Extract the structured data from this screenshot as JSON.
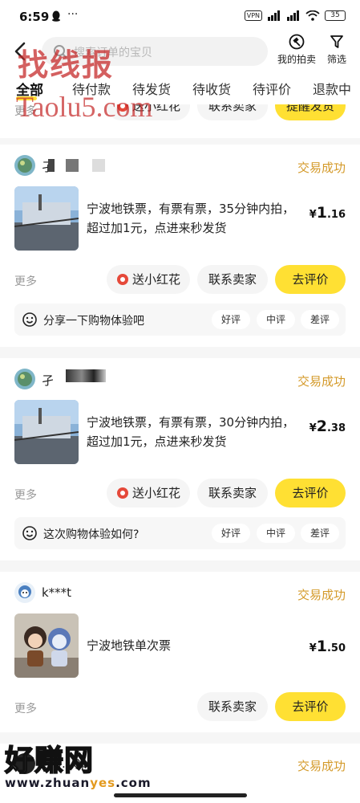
{
  "status_bar": {
    "time": "6:59",
    "more": "···",
    "vpn": "VPN",
    "battery": "35"
  },
  "header": {
    "search_placeholder": "搜索订单的宝贝",
    "my_auctions": "我的拍卖",
    "filter": "筛选"
  },
  "tabs": [
    {
      "label": "全部",
      "active": true
    },
    {
      "label": "待付款"
    },
    {
      "label": "待发货"
    },
    {
      "label": "待收货"
    },
    {
      "label": "待评价"
    },
    {
      "label": "退款中"
    }
  ],
  "partial_card": {
    "more": "更多",
    "flower": "送小红花",
    "contact": "联系卖家",
    "remind": "提醒发货"
  },
  "orders": [
    {
      "seller": "孑",
      "status": "交易成功",
      "title": "宁波地铁票，有票有票，35分钟内拍，超过加1元，点进来秒发货",
      "price_currency": "¥",
      "price_int": "1",
      "price_dec": ".16",
      "more": "更多",
      "flower": "送小红花",
      "contact": "联系卖家",
      "action": "去评价",
      "review_prompt": "分享一下购物体验吧",
      "review_good": "好评",
      "review_mid": "中评",
      "review_bad": "差评"
    },
    {
      "seller": "孑",
      "status": "交易成功",
      "title": "宁波地铁票，有票有票，30分钟内拍，超过加1元，点进来秒发货",
      "price_currency": "¥",
      "price_int": "2",
      "price_dec": ".38",
      "more": "更多",
      "flower": "送小红花",
      "contact": "联系卖家",
      "action": "去评价",
      "review_prompt": "这次购物体验如何?",
      "review_good": "好评",
      "review_mid": "中评",
      "review_bad": "差评"
    },
    {
      "seller": "k***t",
      "status": "交易成功",
      "title": "宁波地铁单次票",
      "price_currency": "¥",
      "price_int": "1",
      "price_dec": ".50",
      "more": "更多",
      "contact": "联系卖家",
      "action": "去评价"
    },
    {
      "seller": "tb0...0pl",
      "status": "交易成功"
    }
  ],
  "watermarks": {
    "top": "找线报",
    "top_sub": "Taolu5.com",
    "bottom": "好赚网",
    "bottom_sub_a": "www.zhuan",
    "bottom_sub_b": "yes",
    "bottom_sub_c": ".com"
  },
  "colors": {
    "accent_yellow": "#ffe033",
    "status_gold": "#d49a2a",
    "watermark_red": "#c62b2b"
  }
}
